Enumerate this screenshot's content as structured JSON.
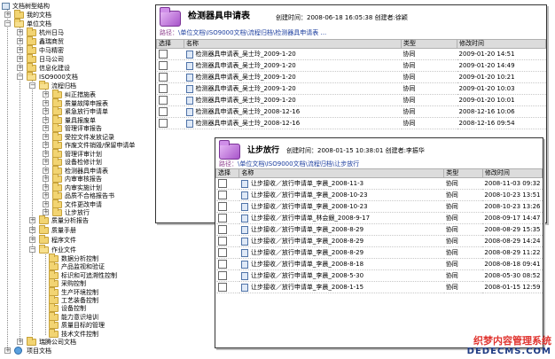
{
  "tree": {
    "root": "文档树型结构",
    "my_docs": "我的文档",
    "unit_docs": "单位文档",
    "companies": [
      "杭州日马",
      "鑫瑞商贸",
      "中马精密",
      "日马公司",
      "信息化建设"
    ],
    "iso": "ISO9000文档",
    "process": "流程归档",
    "process_items": [
      "纠正措施表",
      "质量故障申报表",
      "紧急放行申请单",
      "量具报废单",
      "管理评审报告",
      "受控文件发放记录",
      "作废文件销毁/保留申请单",
      "管理评审计划",
      "设备检修计划",
      "检测器具申请表",
      "内审审核报告",
      "内审实施计划",
      "品质不合格报告书",
      "文件更改申请",
      "让步放行"
    ],
    "quality_analysis": "质量分析报告",
    "quality_manual": "质量手册",
    "program_docs": "程序文件",
    "work_docs": "作业文件",
    "work_items": [
      "数据分析控制",
      "产品监视和验证",
      "标识和可追溯性控制",
      "采购控制",
      "生产环境控制",
      "工艺装备控制",
      "设备控制",
      "能力意识培训",
      "质量目标的管理",
      "技术文件控制"
    ],
    "ruiteng": "瑞腾公司文档",
    "project": "项目文档"
  },
  "panel1": {
    "title": "检测器具申请表",
    "meta": "创建时间：2008-06-18 16:05:38  创建者:徐颖",
    "path_label": "路径：",
    "path_value": "\\单位文档\\ISO9000文档\\流程归档\\检测器具申请表",
    "path_more": "...",
    "headers": [
      "选择",
      "名称",
      "类型",
      "修改时间"
    ],
    "rows": [
      {
        "name": "检测器具申请表_吴士玲_2009-1-20",
        "type": "协同",
        "time": "2009-01-20 14:51"
      },
      {
        "name": "检测器具申请表_吴士玲_2009-1-20",
        "type": "协同",
        "time": "2009-01-20 14:49"
      },
      {
        "name": "检测器具申请表_吴士玲_2009-1-20",
        "type": "协同",
        "time": "2009-01-20 10:21"
      },
      {
        "name": "检测器具申请表_吴士玲_2009-1-20",
        "type": "协同",
        "time": "2009-01-20 10:03"
      },
      {
        "name": "检测器具申请表_吴士玲_2009-1-20",
        "type": "协同",
        "time": "2009-01-20 10:01"
      },
      {
        "name": "检测器具申请表_吴士玲_2008-12-16",
        "type": "协同",
        "time": "2008-12-16 10:06"
      },
      {
        "name": "检测器具申请表_吴士玲_2008-12-16",
        "type": "协同",
        "time": "2008-12-16 09:54"
      }
    ]
  },
  "panel2": {
    "title": "让步放行",
    "meta": "创建时间：2008-01-15 10:38:01  创建者:李振华",
    "path_label": "路径：",
    "path_value": "\\单位文档\\ISO9000文档\\流程归档\\让步放行",
    "headers": [
      "选择",
      "名称",
      "类型",
      "修改时间"
    ],
    "rows": [
      {
        "name": "让步接收／放行申请单_李晨_2008-11-3",
        "type": "协同",
        "time": "2008-11-03 09:32"
      },
      {
        "name": "让步接收／放行申请单_李晨_2008-10-23",
        "type": "协同",
        "time": "2008-10-23 13:51"
      },
      {
        "name": "让步接收／放行申请单_李晨_2008-10-23",
        "type": "协同",
        "time": "2008-10-23 13:26"
      },
      {
        "name": "让步接收／放行申请单_林会銀_2008-9-17",
        "type": "协同",
        "time": "2008-09-17 14:47"
      },
      {
        "name": "让步接收／放行申请单_李晨_2008-8-29",
        "type": "协同",
        "time": "2008-08-29 15:35"
      },
      {
        "name": "让步接收／放行申请单_李晨_2008-8-29",
        "type": "协同",
        "time": "2008-08-29 14:24"
      },
      {
        "name": "让步接收／放行申请单_李晨_2008-8-29",
        "type": "协同",
        "time": "2008-08-29 11:22"
      },
      {
        "name": "让步接收／放行申请单_李晨_2008-8-18",
        "type": "协同",
        "time": "2008-08-18 09:41"
      },
      {
        "name": "让步接收／放行申请单_李晨_2008-5-30",
        "type": "协同",
        "time": "2008-05-30 08:52"
      },
      {
        "name": "让步接收／放行申请单_李晨_2008-1-15",
        "type": "协同",
        "time": "2008-01-15 12:59"
      }
    ]
  },
  "watermark": {
    "line1": "织梦内容管理系统",
    "line2": "DEDECMS.COM"
  }
}
